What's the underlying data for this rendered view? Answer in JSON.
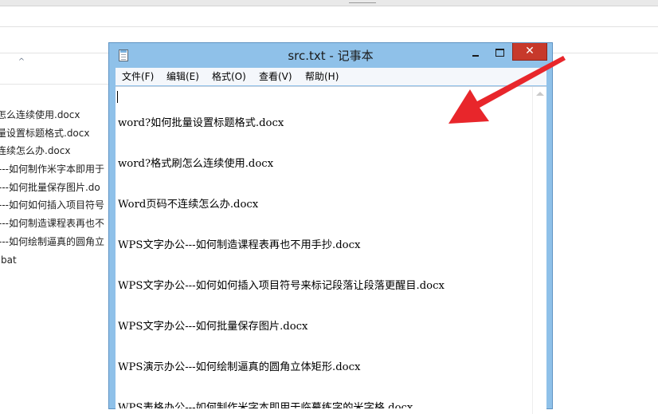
{
  "explorer": {
    "files": [
      "怎么连续使用.docx",
      "量设置标题格式.docx",
      "连续怎么办.docx",
      "---如何制作米字本即用于",
      "---如何批量保存图片.do",
      "---如何如何插入项目符号",
      "---如何制造课程表再也不",
      "---如何绘制逼真的圆角立",
      "bat"
    ]
  },
  "notepad": {
    "title": "src.txt - 记事本",
    "close_glyph": "✕",
    "menu": [
      "文件(F)",
      "编辑(E)",
      "格式(O)",
      "查看(V)",
      "帮助(H)"
    ],
    "lines": [
      "word?如何批量设置标题格式.docx",
      "word?格式刷怎么连续使用.docx",
      "Word页码不连续怎么办.docx",
      "WPS文字办公---如何制造课程表再也不用手抄.docx",
      "WPS文字办公---如何如何插入项目符号来标记段落让段落更醒目.docx",
      "WPS文字办公---如何批量保存图片.docx",
      "WPS演示办公---如何绘制逼真的圆角立体矩形.docx",
      "WPS表格办公---如何制作米字本即用于临摹练字的米字格.docx"
    ]
  },
  "annotation": {
    "color": "#e8262b",
    "icon": "arrow-icon"
  }
}
